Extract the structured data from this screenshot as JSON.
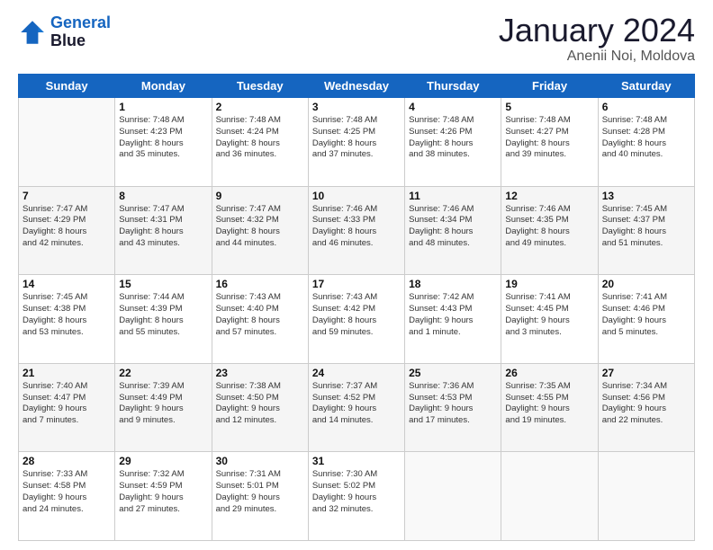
{
  "logo": {
    "line1": "General",
    "line2": "Blue"
  },
  "title": "January 2024",
  "location": "Anenii Noi, Moldova",
  "headers": [
    "Sunday",
    "Monday",
    "Tuesday",
    "Wednesday",
    "Thursday",
    "Friday",
    "Saturday"
  ],
  "weeks": [
    [
      {
        "num": "",
        "text": ""
      },
      {
        "num": "1",
        "text": "Sunrise: 7:48 AM\nSunset: 4:23 PM\nDaylight: 8 hours\nand 35 minutes."
      },
      {
        "num": "2",
        "text": "Sunrise: 7:48 AM\nSunset: 4:24 PM\nDaylight: 8 hours\nand 36 minutes."
      },
      {
        "num": "3",
        "text": "Sunrise: 7:48 AM\nSunset: 4:25 PM\nDaylight: 8 hours\nand 37 minutes."
      },
      {
        "num": "4",
        "text": "Sunrise: 7:48 AM\nSunset: 4:26 PM\nDaylight: 8 hours\nand 38 minutes."
      },
      {
        "num": "5",
        "text": "Sunrise: 7:48 AM\nSunset: 4:27 PM\nDaylight: 8 hours\nand 39 minutes."
      },
      {
        "num": "6",
        "text": "Sunrise: 7:48 AM\nSunset: 4:28 PM\nDaylight: 8 hours\nand 40 minutes."
      }
    ],
    [
      {
        "num": "7",
        "text": "Sunrise: 7:47 AM\nSunset: 4:29 PM\nDaylight: 8 hours\nand 42 minutes."
      },
      {
        "num": "8",
        "text": "Sunrise: 7:47 AM\nSunset: 4:31 PM\nDaylight: 8 hours\nand 43 minutes."
      },
      {
        "num": "9",
        "text": "Sunrise: 7:47 AM\nSunset: 4:32 PM\nDaylight: 8 hours\nand 44 minutes."
      },
      {
        "num": "10",
        "text": "Sunrise: 7:46 AM\nSunset: 4:33 PM\nDaylight: 8 hours\nand 46 minutes."
      },
      {
        "num": "11",
        "text": "Sunrise: 7:46 AM\nSunset: 4:34 PM\nDaylight: 8 hours\nand 48 minutes."
      },
      {
        "num": "12",
        "text": "Sunrise: 7:46 AM\nSunset: 4:35 PM\nDaylight: 8 hours\nand 49 minutes."
      },
      {
        "num": "13",
        "text": "Sunrise: 7:45 AM\nSunset: 4:37 PM\nDaylight: 8 hours\nand 51 minutes."
      }
    ],
    [
      {
        "num": "14",
        "text": "Sunrise: 7:45 AM\nSunset: 4:38 PM\nDaylight: 8 hours\nand 53 minutes."
      },
      {
        "num": "15",
        "text": "Sunrise: 7:44 AM\nSunset: 4:39 PM\nDaylight: 8 hours\nand 55 minutes."
      },
      {
        "num": "16",
        "text": "Sunrise: 7:43 AM\nSunset: 4:40 PM\nDaylight: 8 hours\nand 57 minutes."
      },
      {
        "num": "17",
        "text": "Sunrise: 7:43 AM\nSunset: 4:42 PM\nDaylight: 8 hours\nand 59 minutes."
      },
      {
        "num": "18",
        "text": "Sunrise: 7:42 AM\nSunset: 4:43 PM\nDaylight: 9 hours\nand 1 minute."
      },
      {
        "num": "19",
        "text": "Sunrise: 7:41 AM\nSunset: 4:45 PM\nDaylight: 9 hours\nand 3 minutes."
      },
      {
        "num": "20",
        "text": "Sunrise: 7:41 AM\nSunset: 4:46 PM\nDaylight: 9 hours\nand 5 minutes."
      }
    ],
    [
      {
        "num": "21",
        "text": "Sunrise: 7:40 AM\nSunset: 4:47 PM\nDaylight: 9 hours\nand 7 minutes."
      },
      {
        "num": "22",
        "text": "Sunrise: 7:39 AM\nSunset: 4:49 PM\nDaylight: 9 hours\nand 9 minutes."
      },
      {
        "num": "23",
        "text": "Sunrise: 7:38 AM\nSunset: 4:50 PM\nDaylight: 9 hours\nand 12 minutes."
      },
      {
        "num": "24",
        "text": "Sunrise: 7:37 AM\nSunset: 4:52 PM\nDaylight: 9 hours\nand 14 minutes."
      },
      {
        "num": "25",
        "text": "Sunrise: 7:36 AM\nSunset: 4:53 PM\nDaylight: 9 hours\nand 17 minutes."
      },
      {
        "num": "26",
        "text": "Sunrise: 7:35 AM\nSunset: 4:55 PM\nDaylight: 9 hours\nand 19 minutes."
      },
      {
        "num": "27",
        "text": "Sunrise: 7:34 AM\nSunset: 4:56 PM\nDaylight: 9 hours\nand 22 minutes."
      }
    ],
    [
      {
        "num": "28",
        "text": "Sunrise: 7:33 AM\nSunset: 4:58 PM\nDaylight: 9 hours\nand 24 minutes."
      },
      {
        "num": "29",
        "text": "Sunrise: 7:32 AM\nSunset: 4:59 PM\nDaylight: 9 hours\nand 27 minutes."
      },
      {
        "num": "30",
        "text": "Sunrise: 7:31 AM\nSunset: 5:01 PM\nDaylight: 9 hours\nand 29 minutes."
      },
      {
        "num": "31",
        "text": "Sunrise: 7:30 AM\nSunset: 5:02 PM\nDaylight: 9 hours\nand 32 minutes."
      },
      {
        "num": "",
        "text": ""
      },
      {
        "num": "",
        "text": ""
      },
      {
        "num": "",
        "text": ""
      }
    ]
  ]
}
